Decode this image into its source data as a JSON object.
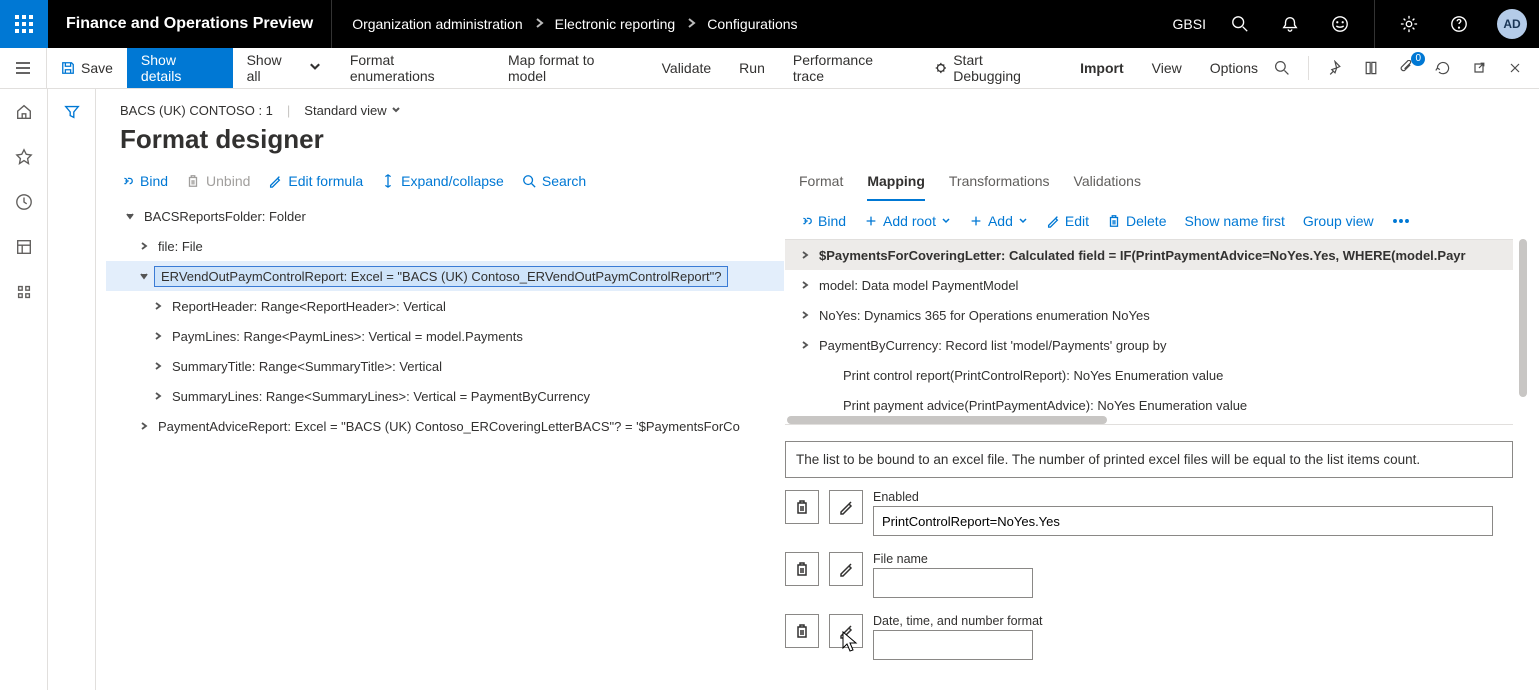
{
  "topbar": {
    "app_title": "Finance and Operations Preview",
    "breadcrumb": [
      "Organization administration",
      "Electronic reporting",
      "Configurations"
    ],
    "org": "GBSI",
    "avatar": "AD"
  },
  "actionbar": {
    "save": "Save",
    "show_details": "Show details",
    "show_all": "Show all",
    "format_enum": "Format enumerations",
    "map_model": "Map format to model",
    "validate": "Validate",
    "run": "Run",
    "perf_trace": "Performance trace",
    "start_debug": "Start Debugging",
    "import": "Import",
    "view": "View",
    "options": "Options",
    "badge_count": "0"
  },
  "page": {
    "context1": "BACS (UK) CONTOSO : 1",
    "context2": "Standard view",
    "title": "Format designer"
  },
  "left_cmds": {
    "bind": "Bind",
    "unbind": "Unbind",
    "edit_formula": "Edit formula",
    "expand": "Expand/collapse",
    "search": "Search"
  },
  "tree": [
    {
      "level": 0,
      "state": "open",
      "text": "BACSReportsFolder: Folder"
    },
    {
      "level": 1,
      "state": "closed",
      "text": "file: File"
    },
    {
      "level": 1,
      "state": "open",
      "text": "ERVendOutPaymControlReport: Excel = \"BACS (UK) Contoso_ERVendOutPaymControlReport\"?",
      "selected": true
    },
    {
      "level": 2,
      "state": "closed",
      "text": "ReportHeader: Range<ReportHeader>: Vertical"
    },
    {
      "level": 2,
      "state": "closed",
      "text": "PaymLines: Range<PaymLines>: Vertical = model.Payments"
    },
    {
      "level": 2,
      "state": "closed",
      "text": "SummaryTitle: Range<SummaryTitle>: Vertical"
    },
    {
      "level": 2,
      "state": "closed",
      "text": "SummaryLines: Range<SummaryLines>: Vertical = PaymentByCurrency"
    },
    {
      "level": 1,
      "state": "closed",
      "text": "PaymentAdviceReport: Excel = \"BACS (UK) Contoso_ERCoveringLetterBACS\"? = '$PaymentsForCo"
    }
  ],
  "tabs": {
    "format": "Format",
    "mapping": "Mapping",
    "transformations": "Transformations",
    "validations": "Validations"
  },
  "right_cmds": {
    "bind": "Bind",
    "add_root": "Add root",
    "add": "Add",
    "edit": "Edit",
    "delete": "Delete",
    "show_name_first": "Show name first",
    "group_view": "Group view"
  },
  "rtree": [
    {
      "tw": "closed",
      "text": "$PaymentsForCoveringLetter: Calculated field = IF(PrintPaymentAdvice=NoYes.Yes, WHERE(model.Payr",
      "selected": true
    },
    {
      "tw": "closed",
      "text": "model: Data model PaymentModel"
    },
    {
      "tw": "closed",
      "text": "NoYes: Dynamics 365 for Operations enumeration NoYes"
    },
    {
      "tw": "closed",
      "text": "PaymentByCurrency: Record list 'model/Payments' group by"
    },
    {
      "tw": "none",
      "text": "Print control report(PrintControlReport): NoYes Enumeration value"
    },
    {
      "tw": "none",
      "text": "Print payment advice(PrintPaymentAdvice): NoYes Enumeration value"
    }
  ],
  "info_text": "The list to be bound to an excel file. The number of printed excel files will be equal to the list items count.",
  "form": {
    "enabled_label": "Enabled",
    "enabled_value": "PrintControlReport=NoYes.Yes",
    "filename_label": "File name",
    "filename_value": "",
    "dateformat_label": "Date, time, and number format",
    "dateformat_value": ""
  }
}
